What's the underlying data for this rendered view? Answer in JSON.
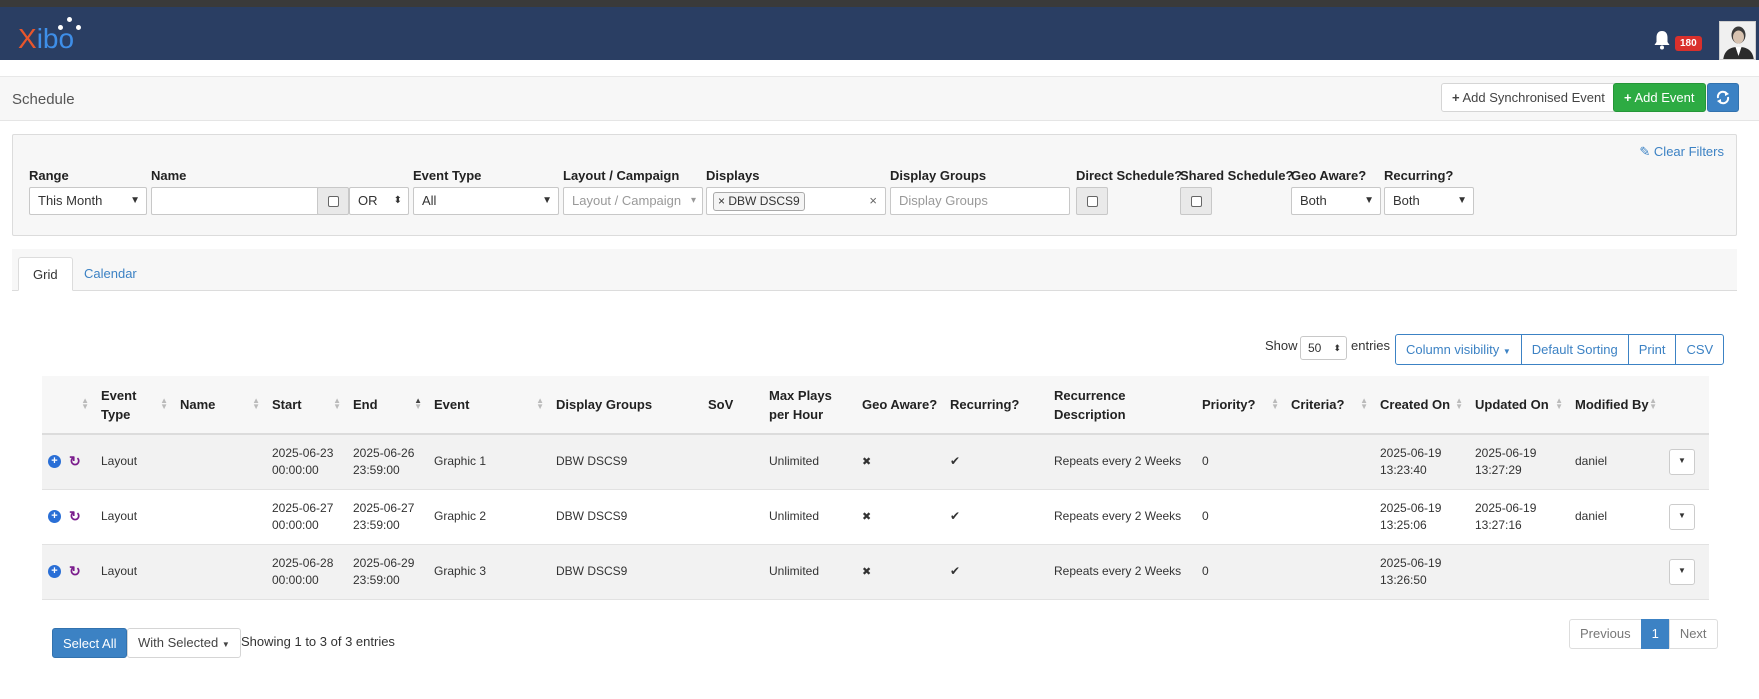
{
  "app": {
    "logo_first": "X",
    "logo_rest": "ibo",
    "notification_count": "180",
    "icons": {
      "bell": "bell-icon",
      "avatar": "user-avatar"
    }
  },
  "header": {
    "title": "Schedule",
    "add_sync_label": "Add Synchronised Event",
    "add_event_label": "Add Event",
    "refresh_icon": "refresh-icon"
  },
  "filters": {
    "clear_label": "Clear Filters",
    "range": {
      "label": "Range",
      "value": "This Month"
    },
    "name": {
      "label": "Name",
      "value": "",
      "logic": "OR"
    },
    "event_type": {
      "label": "Event Type",
      "value": "All"
    },
    "layout_campaign": {
      "label": "Layout / Campaign",
      "placeholder": "Layout / Campaign"
    },
    "displays": {
      "label": "Displays",
      "tag": "DBW DSCS9"
    },
    "display_groups": {
      "label": "Display Groups",
      "placeholder": "Display Groups"
    },
    "direct_schedule": {
      "label": "Direct Schedule?"
    },
    "shared_schedule": {
      "label": "Shared Schedule?"
    },
    "geo_aware": {
      "label": "Geo Aware?",
      "value": "Both"
    },
    "recurring": {
      "label": "Recurring?",
      "value": "Both"
    }
  },
  "tabs": [
    {
      "label": "Grid",
      "active": true
    },
    {
      "label": "Calendar",
      "active": false
    }
  ],
  "table_controls": {
    "show_label": "Show",
    "page_length": "50",
    "entries_label": "entries",
    "buttons": [
      "Column visibility",
      "Default Sorting",
      "Print",
      "CSV"
    ]
  },
  "table": {
    "headers": [
      "",
      "Event Type",
      "Name",
      "Start",
      "End",
      "Event",
      "Display Groups",
      "SoV",
      "Max Plays per Hour",
      "Geo Aware?",
      "Recurring?",
      "Recurrence Description",
      "Priority?",
      "Criteria?",
      "Created On",
      "Updated On",
      "Modified By",
      ""
    ],
    "rows": [
      {
        "type": "Layout",
        "name": "",
        "start_date": "2025-06-23",
        "start_time": "00:00:00",
        "end_date": "2025-06-26",
        "end_time": "23:59:00",
        "event": "Graphic 1",
        "display_groups": "DBW DSCS9",
        "sov": "",
        "max_plays": "Unlimited",
        "geo_aware": "✖",
        "recurring": "✔",
        "recurrence": "Repeats every 2 Weeks",
        "priority": "0",
        "criteria": "",
        "created_date": "2025-06-19",
        "created_time": "13:23:40",
        "updated_date": "2025-06-19",
        "updated_time": "13:27:29",
        "modified_by": "daniel"
      },
      {
        "type": "Layout",
        "name": "",
        "start_date": "2025-06-27",
        "start_time": "00:00:00",
        "end_date": "2025-06-27",
        "end_time": "23:59:00",
        "event": "Graphic 2",
        "display_groups": "DBW DSCS9",
        "sov": "",
        "max_plays": "Unlimited",
        "geo_aware": "✖",
        "recurring": "✔",
        "recurrence": "Repeats every 2 Weeks",
        "priority": "0",
        "criteria": "",
        "created_date": "2025-06-19",
        "created_time": "13:25:06",
        "updated_date": "2025-06-19",
        "updated_time": "13:27:16",
        "modified_by": "daniel"
      },
      {
        "type": "Layout",
        "name": "",
        "start_date": "2025-06-28",
        "start_time": "00:00:00",
        "end_date": "2025-06-29",
        "end_time": "23:59:00",
        "event": "Graphic 3",
        "display_groups": "DBW DSCS9",
        "sov": "",
        "max_plays": "Unlimited",
        "geo_aware": "✖",
        "recurring": "✔",
        "recurrence": "Repeats every 2 Weeks",
        "priority": "0",
        "criteria": "",
        "created_date": "2025-06-19",
        "created_time": "13:26:50",
        "updated_date": "",
        "updated_time": "",
        "modified_by": ""
      }
    ]
  },
  "footer": {
    "select_all_label": "Select All",
    "with_selected_label": "With Selected",
    "info": "Showing 1 to 3 of 3 entries",
    "pagination": {
      "previous": "Previous",
      "current": "1",
      "next": "Next"
    }
  },
  "colors": {
    "navbar": "#2a3e63",
    "primary": "#3c82c4",
    "success": "#2dab43",
    "badge": "#d9302c",
    "logo_orange": "#e8562c",
    "logo_blue": "#3e8ee8"
  }
}
